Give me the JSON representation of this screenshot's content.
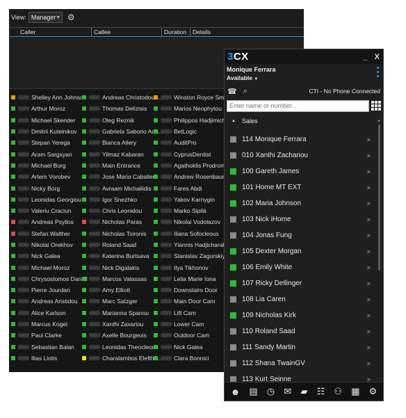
{
  "manager": {
    "view_label": "View:",
    "view_value": "Manager",
    "columns": [
      "Caller",
      "Callee",
      "Duration",
      "Details"
    ],
    "extensions": [
      [
        {
          "name": "Shelley Ann Johnson",
          "status": "#f0960a"
        },
        {
          "name": "Arthur Moroz",
          "status": "#2ebd34"
        },
        {
          "name": "Michael Skender",
          "status": "#2ebd34"
        },
        {
          "name": "Dmitrii Kuteinikov",
          "status": "#2ebd34"
        },
        {
          "name": "Stepan Yerega",
          "status": "#2ebd34"
        },
        {
          "name": "Aram Sargsyan",
          "status": "#2ebd34"
        },
        {
          "name": "Michael Borg",
          "status": "#2ebd34"
        },
        {
          "name": "Artem Vorobev",
          "status": "#2ebd34"
        },
        {
          "name": "Nicky Borg",
          "status": "#2ebd34"
        },
        {
          "name": "Leonidas Georgiou",
          "status": "#2ebd34"
        },
        {
          "name": "Valeriu Craciun",
          "status": "#2ebd34"
        },
        {
          "name": "Andreas Psyllos",
          "status": "#e04a4a"
        },
        {
          "name": "Stefan Walther",
          "status": "#e04a4a"
        },
        {
          "name": "Nikolai Orekhov",
          "status": "#2ebd34"
        },
        {
          "name": "Nick Galea",
          "status": "#2ebd34"
        },
        {
          "name": "Michael Moroz",
          "status": "#2ebd34"
        },
        {
          "name": "Chrysostomos Daniel",
          "status": "#2ebd34"
        },
        {
          "name": "Pierre Jourdan",
          "status": "#2ebd34"
        },
        {
          "name": "Andreas Aristidou",
          "status": "#2ebd34"
        },
        {
          "name": "Alice Karlson",
          "status": "#2ebd34"
        },
        {
          "name": "Marcus Kogel",
          "status": "#2ebd34"
        },
        {
          "name": "Paul Clarke",
          "status": "#2ebd34"
        },
        {
          "name": "Sebastian Balan",
          "status": "#2ebd34"
        },
        {
          "name": "Ilias Liotis",
          "status": "#2ebd34"
        }
      ],
      [
        {
          "name": "Andreas Christodoul...",
          "status": "#2ebd34"
        },
        {
          "name": "Thomas Delizisis",
          "status": "#2ebd34"
        },
        {
          "name": "Oleg Reznik",
          "status": "#2ebd34"
        },
        {
          "name": "Gabriela Saborio Ada...",
          "status": "#2ebd34"
        },
        {
          "name": "Bianca Allery",
          "status": "#2ebd34"
        },
        {
          "name": "Yilmaz Kabaran",
          "status": "#2ebd34"
        },
        {
          "name": "Main Entrance",
          "status": "#2ebd34"
        },
        {
          "name": "Jose Maria Caballero",
          "status": "#2ebd34"
        },
        {
          "name": "Avraam Michailidis",
          "status": "#2ebd34"
        },
        {
          "name": "Igor Snezhko",
          "status": "#2ebd34"
        },
        {
          "name": "Chris Leonidou",
          "status": "#2ebd34"
        },
        {
          "name": "Nicholas Paras",
          "status": "#e04a4a"
        },
        {
          "name": "Nicholas Tsironis",
          "status": "#2ebd34"
        },
        {
          "name": "Roland Saad",
          "status": "#2ebd34"
        },
        {
          "name": "Katerina Burtsava",
          "status": "#2ebd34"
        },
        {
          "name": "Nick Digalakis",
          "status": "#2ebd34"
        },
        {
          "name": "Marcos Valassas",
          "status": "#2ebd34"
        },
        {
          "name": "Amy Elliott",
          "status": "#2ebd34"
        },
        {
          "name": "Marc Satzger",
          "status": "#2ebd34"
        },
        {
          "name": "Marianna Spanou",
          "status": "#2ebd34"
        },
        {
          "name": "Xanthi Zaxariou",
          "status": "#2ebd34"
        },
        {
          "name": "Axelle Bourgeois",
          "status": "#2ebd34"
        },
        {
          "name": "Leonidas Theocleous",
          "status": "#2ebd34"
        },
        {
          "name": "Charalambos Elefthe...",
          "status": "#f0e020"
        }
      ],
      [
        {
          "name": "Winston Royce Smith",
          "status": "#f0960a"
        },
        {
          "name": "Marios Neophytou",
          "status": "#2ebd34"
        },
        {
          "name": "Philippos Hadjimichael",
          "status": "#2ebd34"
        },
        {
          "name": "BetLogic",
          "status": "#2ebd34"
        },
        {
          "name": "AuditPro",
          "status": "#2ebd34"
        },
        {
          "name": "CyprusDentist",
          "status": "#2ebd34"
        },
        {
          "name": "Agathoklis Prodromou",
          "status": "#2ebd34"
        },
        {
          "name": "Andrew Rosenbaum",
          "status": "#2ebd34"
        },
        {
          "name": "Fares Abdi",
          "status": "#2ebd34"
        },
        {
          "name": "Yakov Karnygin",
          "status": "#2ebd34"
        },
        {
          "name": "Marko Sipilä",
          "status": "#2ebd34"
        },
        {
          "name": "Nikolai Vodolazov",
          "status": "#2ebd34"
        },
        {
          "name": "Iliana Sofocleous",
          "status": "#2ebd34"
        },
        {
          "name": "Yiannis Hadjicharalambous",
          "status": "#2ebd34"
        },
        {
          "name": "Stanislav Zagurskiy",
          "status": "#2ebd34"
        },
        {
          "name": "Ilya Tikhonov",
          "status": "#2ebd34"
        },
        {
          "name": "Lelia Marie Iona",
          "status": "#2ebd34"
        },
        {
          "name": "Downstairs Door",
          "status": "#2ebd34"
        },
        {
          "name": "Main Door Cam",
          "status": "#2ebd34"
        },
        {
          "name": "Lift Cam",
          "status": "#2ebd34"
        },
        {
          "name": "Lower Cam",
          "status": "#2ebd34"
        },
        {
          "name": "Outdoor Cam",
          "status": "#2ebd34"
        },
        {
          "name": "Nick Galea",
          "status": "#2ebd34"
        },
        {
          "name": "Clara Bonnici",
          "status": "#2ebd34"
        }
      ]
    ]
  },
  "client": {
    "logo_left": "3",
    "logo_right": "CX",
    "minimize": "_",
    "close": "X",
    "user_name": "Monique Ferrara",
    "user_status": "Available",
    "cti_status": "CTI - No Phone Connected",
    "search_placeholder": "Enter name or number...",
    "group_name": "Sales",
    "contacts": [
      {
        "label": "114 Monique Ferrara",
        "status": "#8a8a8a"
      },
      {
        "label": "010 Xanthi Zachariou",
        "status": "#8a8a8a"
      },
      {
        "label": "100 Gareth James",
        "status": "#2ebd34"
      },
      {
        "label": "101 Home MT EXT",
        "status": "#2ebd34"
      },
      {
        "label": "102 Maria Johnson",
        "status": "#2ebd34"
      },
      {
        "label": "103 Nick iHome",
        "status": "#8a8a8a"
      },
      {
        "label": "104 Jonas Fung",
        "status": "#8a8a8a"
      },
      {
        "label": "105 Dexter Morgan",
        "status": "#2ebd34"
      },
      {
        "label": "106 Emily White",
        "status": "#2ebd34"
      },
      {
        "label": "107 Ricky Dellinger",
        "status": "#2ebd34"
      },
      {
        "label": "108 Lia Caren",
        "status": "#8a8a8a"
      },
      {
        "label": "109 Nicholas Kirk",
        "status": "#2ebd34"
      },
      {
        "label": "110 Roland Saad",
        "status": "#8a8a8a"
      },
      {
        "label": "111 Sandy Martin",
        "status": "#8a8a8a"
      },
      {
        "label": "112 Shana TwainGV",
        "status": "#8a8a8a"
      },
      {
        "label": "113 Kurt Seinne",
        "status": "#8a8a8a"
      }
    ],
    "arrow": ">",
    "bottom_icons": [
      "contacts-icon",
      "call-log-icon",
      "history-icon",
      "voicemail-icon",
      "chat-icon",
      "presence-icon",
      "conference-icon",
      "switchboard-icon",
      "settings-icon"
    ]
  },
  "colors": {
    "accent": "#1e96e8",
    "available": "#2ebd34",
    "busy": "#e04a4a",
    "away": "#f0960a",
    "offline": "#8a8a8a"
  }
}
